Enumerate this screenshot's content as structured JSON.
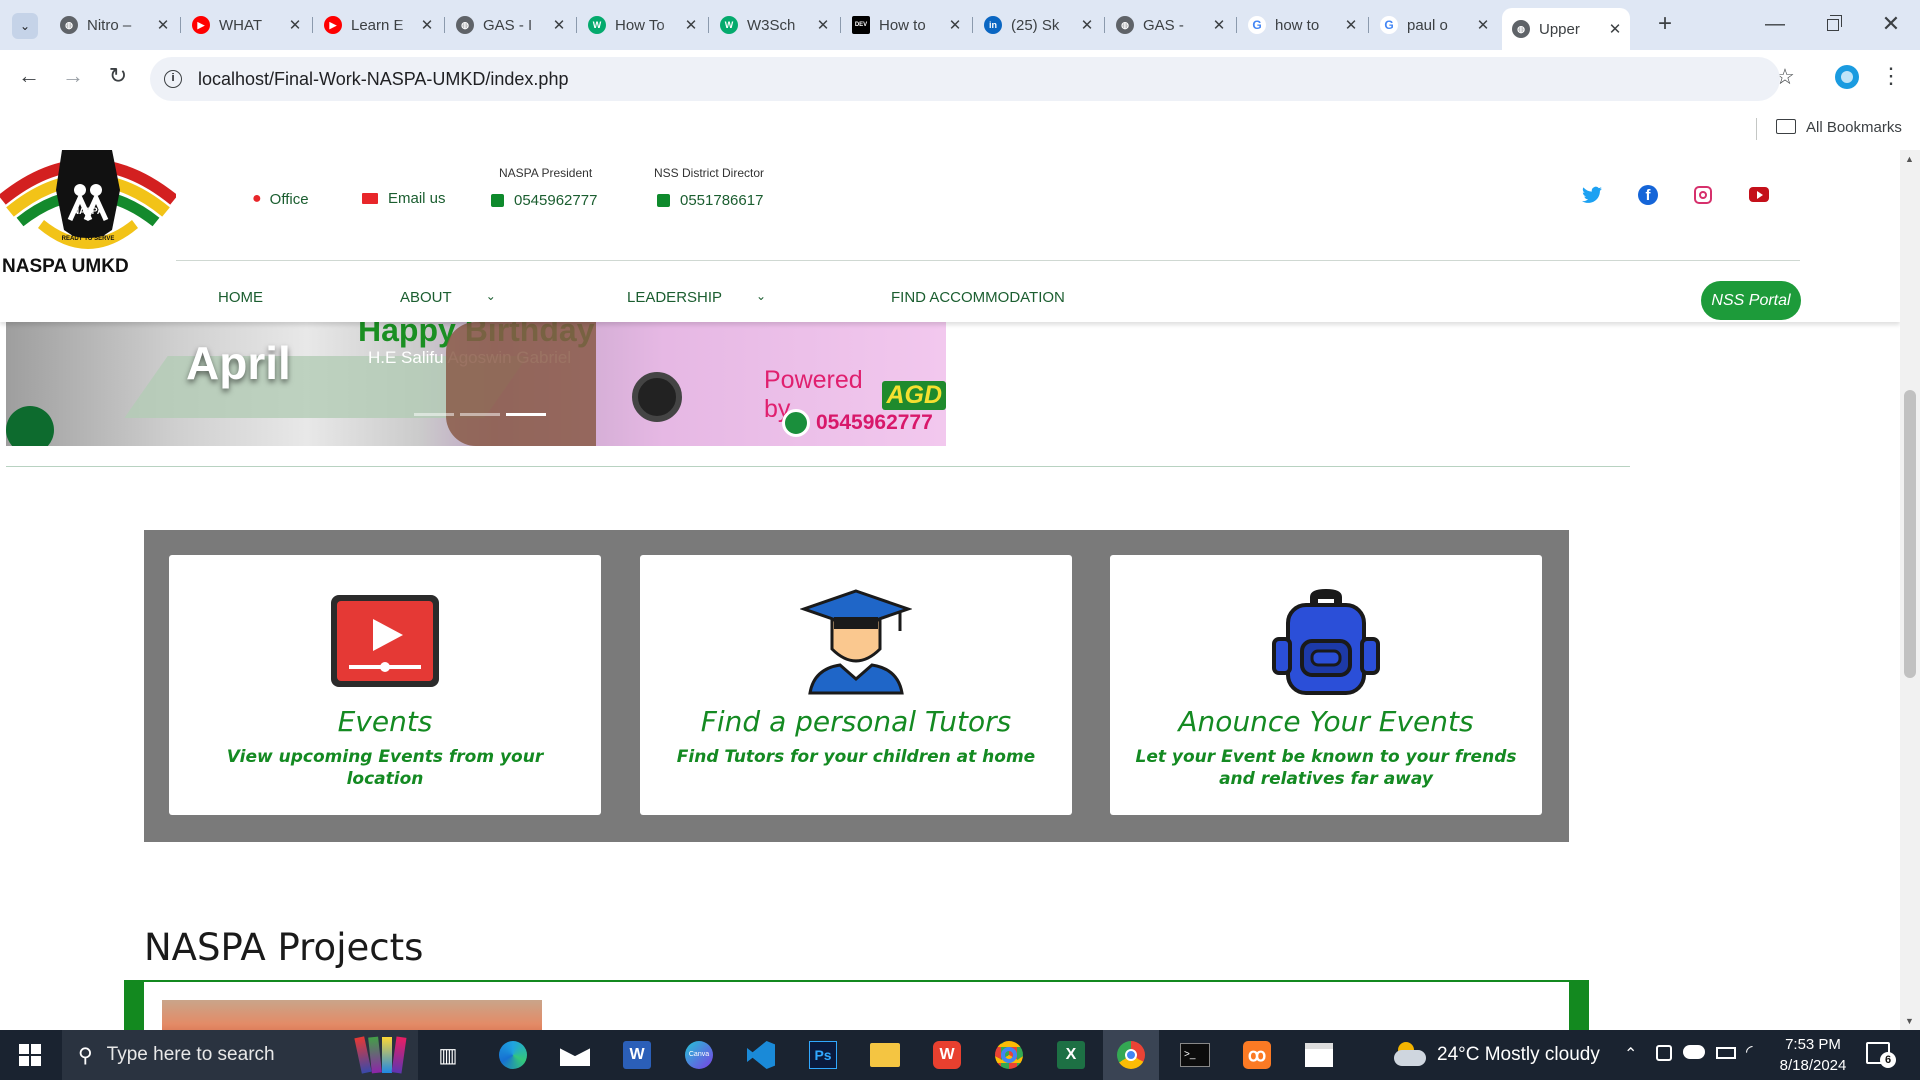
{
  "browser": {
    "tabs": [
      {
        "title": "Nitro –",
        "icon": "globe-icon",
        "color": "#5f6368"
      },
      {
        "title": "WHAT",
        "icon": "youtube-icon",
        "color": "#ff0000"
      },
      {
        "title": "Learn E",
        "icon": "youtube-icon",
        "color": "#ff0000"
      },
      {
        "title": "GAS - I",
        "icon": "globe-icon",
        "color": "#5f6368"
      },
      {
        "title": "How To",
        "icon": "w3schools-icon",
        "color": "#04aa6d"
      },
      {
        "title": "W3Sch",
        "icon": "w3schools-icon",
        "color": "#04aa6d"
      },
      {
        "title": "How to",
        "icon": "dev-icon",
        "color": "#000000"
      },
      {
        "title": "(25) Sk",
        "icon": "linkedin-icon",
        "color": "#0a66c2"
      },
      {
        "title": "GAS -",
        "icon": "globe-icon",
        "color": "#5f6368"
      },
      {
        "title": "how to",
        "icon": "google-icon",
        "color": "#4285f4"
      },
      {
        "title": "paul o",
        "icon": "google-icon",
        "color": "#4285f4"
      },
      {
        "title": "Upper",
        "icon": "globe-icon",
        "color": "#5f6368"
      }
    ],
    "url": "localhost/Final-Work-NASPA-UMKD/index.php",
    "bookmarks_label": "All Bookmarks"
  },
  "site": {
    "logo_label": "NASPA",
    "logo_ribbon": "READY TO SERVE",
    "brand": "NASPA UMKD",
    "office_label": "Office",
    "email_label": "Email us",
    "president_title": "NASPA President",
    "president_phone": "0545962777",
    "director_title": "NSS District Director",
    "director_phone": "0551786617",
    "nav": {
      "home": "HOME",
      "about": "ABOUT",
      "leadership": "LEADERSHIP",
      "accommodation": "FIND ACCOMMODATION",
      "portal": "NSS Portal"
    },
    "banner": {
      "headline": "Happy Birthday",
      "month": "April",
      "name": "H.E Salifu Agoswin Gabriel",
      "powered": "Powered by",
      "powered_brand": "AGD",
      "phone": "0545962777"
    },
    "cards": [
      {
        "title": "Events",
        "text": "View upcoming Events from your location",
        "icon": "video-icon"
      },
      {
        "title": "Find a personal Tutors",
        "text": "Find Tutors for your children at home",
        "icon": "graduate-icon"
      },
      {
        "title": "Anounce Your Events",
        "text": "Let your Event be known to your frends and relatives far away",
        "icon": "backpack-icon"
      }
    ],
    "projects_heading": "NASPA Projects",
    "colors": {
      "brand_green": "#0e8a2c",
      "card_text": "#148a22",
      "panel_gray": "#7a7a7a"
    }
  },
  "taskbar": {
    "search_placeholder": "Type here to search",
    "weather": "24°C  Mostly cloudy",
    "time": "7:53 PM",
    "date": "8/18/2024",
    "notifications": "6"
  }
}
